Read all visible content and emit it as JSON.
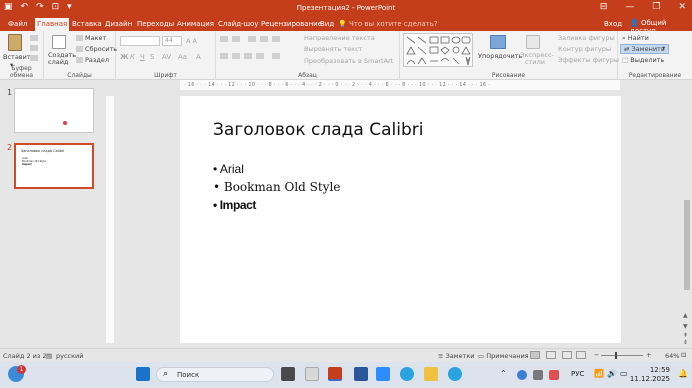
{
  "window": {
    "title": "Презентация2 - PowerPoint"
  },
  "tabs": [
    "Файл",
    "Главная",
    "Вставка",
    "Дизайн",
    "Переходы",
    "Анимация",
    "Слайд-шоу",
    "Рецензирование",
    "Вид"
  ],
  "tell_me": "Что вы хотите сделать?",
  "sign_in": "Вход",
  "share": "Общий доступ",
  "ribbon": {
    "clipboard": {
      "paste": "Вставить",
      "label": "Буфер обмена"
    },
    "slides": {
      "new_slide": "Создать слайд",
      "layout": "Макет",
      "reset": "Сбросить",
      "section": "Раздел",
      "label": "Слайды"
    },
    "font": {
      "size": "44",
      "label": "Шрифт"
    },
    "paragraph": {
      "text_direction": "Направление текста",
      "align_text": "Выровнять текст",
      "smartart": "Преобразовать в SmartArt",
      "label": "Абзац"
    },
    "drawing": {
      "arrange": "Упорядочить",
      "quick_styles": "Экспресс-стили",
      "fill": "Заливка фигуры",
      "outline": "Контур фигуры",
      "effects": "Эффекты фигуры",
      "label": "Рисование"
    },
    "editing": {
      "find": "Найти",
      "replace": "Заменить",
      "select": "Выделить",
      "label": "Редактирование"
    }
  },
  "thumbnails": [
    {
      "num": "1"
    },
    {
      "num": "2",
      "title": "Заголовок слада Calibri",
      "items": [
        "Arial",
        "Bookman Old Style",
        "Impact"
      ]
    }
  ],
  "slide": {
    "title": "Заголовок слада Calibri",
    "bullets": [
      "• Arial",
      "• Bookman Old Style",
      "• Impact"
    ]
  },
  "hruler_ticks": "· 16 · · · 14 · · · 12 · · · 10 · · · 8 · · · 6 · · · 4 · · · 2 · · · 0 · · · 2 · · · 4 · · · 6 · · · 8 · · · 10 · · · 12 · · · 14 · · · 16 ·",
  "status": {
    "slide": "Слайд 2 из 2",
    "lang": "русский",
    "notes": "Заметки",
    "comments": "Примечания",
    "zoom": "64%"
  },
  "taskbar": {
    "search": "Поиск",
    "lang": "РУС",
    "time": "12:59",
    "date": "11.12.2025",
    "badge": "1"
  }
}
